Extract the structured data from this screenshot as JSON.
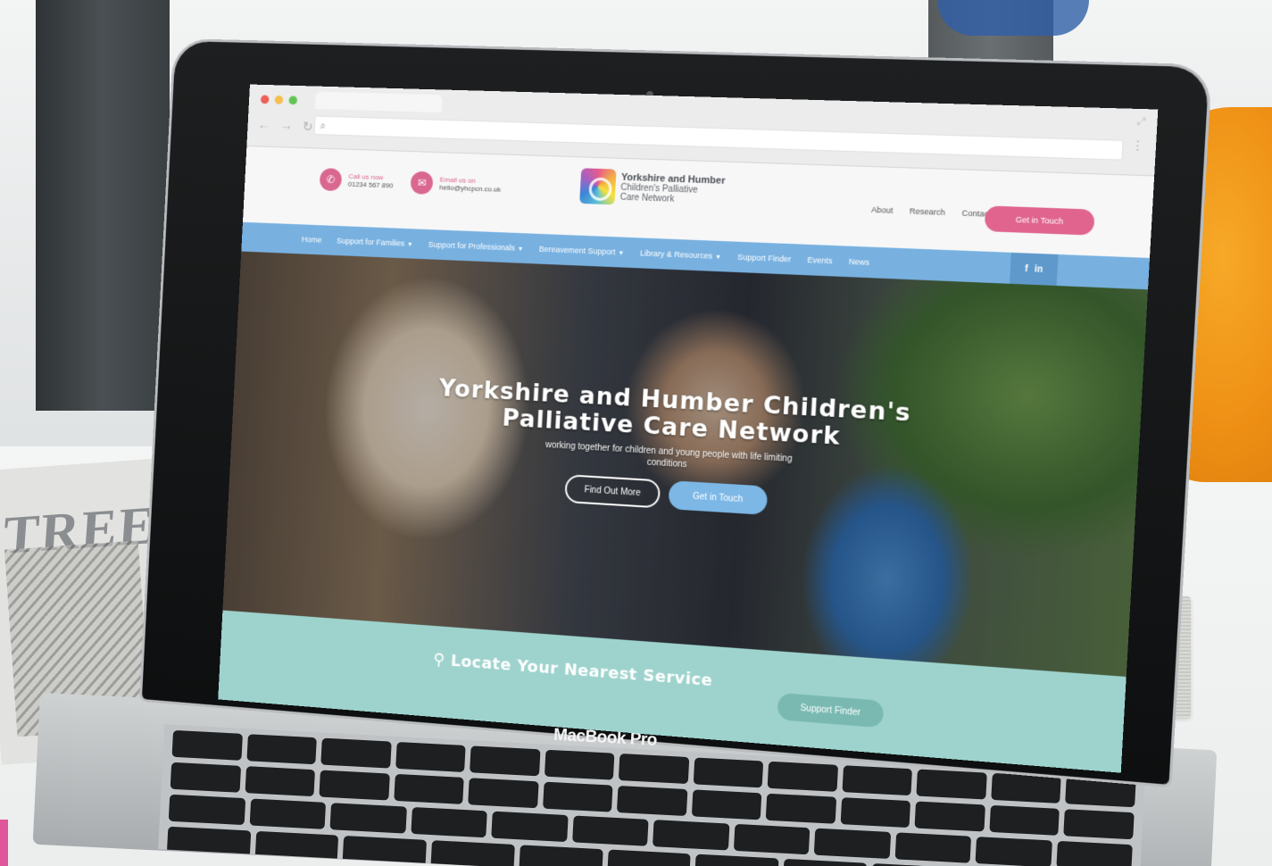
{
  "colors": {
    "brand_pink": "#e0648e",
    "nav_blue": "#78b1e0",
    "button_blue": "#7cb7e6",
    "locate_teal": "#9ed3cd"
  },
  "laptop": {
    "chin_label": "MacBook Pro"
  },
  "background": {
    "magazine_word": "TREE"
  },
  "site": {
    "header": {
      "call": {
        "label": "Call us now",
        "value": "01234 567 890",
        "icon": "phone-icon"
      },
      "email": {
        "label": "Email us on",
        "value": "hello@yhcpcn.co.uk",
        "icon": "envelope-icon"
      },
      "logo": {
        "line1": "Yorkshire and Humber",
        "line2": "Children's Palliative",
        "line3": "Care Network"
      },
      "links": [
        "About",
        "Research",
        "Contact"
      ],
      "cta": "Get in Touch"
    },
    "nav": {
      "items": [
        {
          "label": "Home",
          "dropdown": false
        },
        {
          "label": "Support for Families",
          "dropdown": true
        },
        {
          "label": "Support for Professionals",
          "dropdown": true
        },
        {
          "label": "Bereavement Support",
          "dropdown": true
        },
        {
          "label": "Library & Resources",
          "dropdown": true
        },
        {
          "label": "Support Finder",
          "dropdown": false
        },
        {
          "label": "Events",
          "dropdown": false
        },
        {
          "label": "News",
          "dropdown": false
        }
      ],
      "social": {
        "facebook": "f",
        "linkedin": "in"
      }
    },
    "hero": {
      "title_line1": "Yorkshire and Humber Children's",
      "title_line2": "Palliative Care Network",
      "subtitle": "working together for children and young people with life limiting conditions",
      "primary_button": "Find Out More",
      "secondary_button": "Get in Touch"
    },
    "locate": {
      "title": "Locate Your Nearest Service",
      "icon": "map-pin-icon",
      "button": "Support Finder"
    }
  }
}
